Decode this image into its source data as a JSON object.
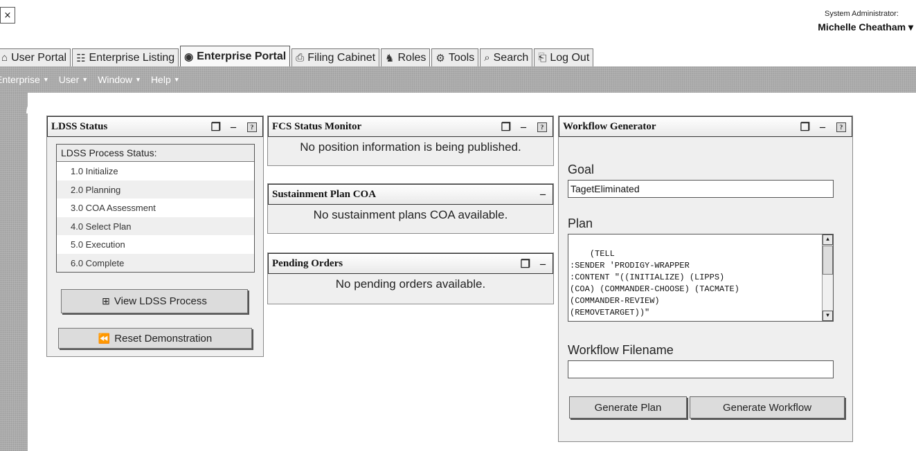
{
  "window": {
    "close_glyph": "×"
  },
  "user": {
    "label": "System Administrator:",
    "name": "Michelle Cheatham ▾"
  },
  "tabs": [
    {
      "label": "User Portal",
      "icon": "home-icon",
      "glyph": "⌂"
    },
    {
      "label": "Enterprise Listing",
      "icon": "listing-icon",
      "glyph": "☷"
    },
    {
      "label": "Enterprise Portal",
      "icon": "portal-icon",
      "glyph": "◉",
      "active": true
    },
    {
      "label": "Filing Cabinet",
      "icon": "cabinet-icon",
      "glyph": "⎙"
    },
    {
      "label": "Roles",
      "icon": "roles-icon",
      "glyph": "♞"
    },
    {
      "label": "Tools",
      "icon": "tools-icon",
      "glyph": "⚙"
    },
    {
      "label": "Search",
      "icon": "search-icon",
      "glyph": "⌕"
    },
    {
      "label": "Log Out",
      "icon": "logout-icon",
      "glyph": "⎗"
    }
  ],
  "menu": [
    {
      "label": "Enterprise"
    },
    {
      "label": "User"
    },
    {
      "label": "Window"
    },
    {
      "label": "Help"
    }
  ],
  "ldss": {
    "title": "LDSS Status",
    "list_header": "LDSS Process Status:",
    "steps": [
      "1.0 Initialize",
      "2.0 Planning",
      "3.0 COA Assessment",
      "4.0 Select Plan",
      "5.0 Execution",
      "6.0 Complete"
    ],
    "view_button": "View LDSS Process",
    "reset_button": "Reset Demonstration"
  },
  "fcs": {
    "title": "FCS Status Monitor",
    "message": "No position information is being published."
  },
  "sustainment": {
    "title": "Sustainment Plan COA",
    "message": "No sustainment plans COA available."
  },
  "pending": {
    "title": "Pending Orders",
    "message": "No pending orders available."
  },
  "workflow": {
    "title": "Workflow Generator",
    "goal_label": "Goal",
    "goal_value": "TagetEliminated",
    "plan_label": "Plan",
    "plan_text": "(TELL\n:SENDER 'PRODIGY-WRAPPER\n:CONTENT \"((INITIALIZE) (LIPPS)\n(COA) (COMMANDER-CHOOSE) (TACMATE)\n(COMMANDER-REVIEW)\n(REMOVETARGET))\"",
    "filename_label": "Workflow Filename",
    "filename_value": "",
    "generate_plan": "Generate Plan",
    "generate_workflow": "Generate Workflow"
  },
  "controls": {
    "props_glyph": "❐",
    "min_glyph": "–",
    "help_glyph": "?"
  }
}
